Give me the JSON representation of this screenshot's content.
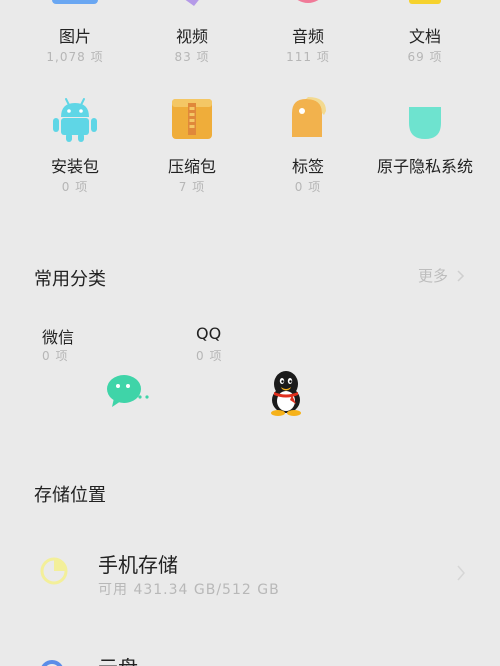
{
  "categories_row1": [
    {
      "label": "图片",
      "count": "1,078 项",
      "icon": "image-icon"
    },
    {
      "label": "视频",
      "count": "83 项",
      "icon": "video-icon"
    },
    {
      "label": "音频",
      "count": "111 项",
      "icon": "audio-icon"
    },
    {
      "label": "文档",
      "count": "69 项",
      "icon": "document-icon"
    }
  ],
  "categories_row2": [
    {
      "label": "安装包",
      "count": "0 项",
      "icon": "android-icon"
    },
    {
      "label": "压缩包",
      "count": "7 项",
      "icon": "archive-icon"
    },
    {
      "label": "标签",
      "count": "0 项",
      "icon": "tag-icon"
    },
    {
      "label": "原子隐私系统",
      "count": "",
      "icon": "privacy-shield-icon"
    }
  ],
  "common": {
    "title": "常用分类",
    "more": "更多",
    "items": [
      {
        "label": "微信",
        "count": "0 项",
        "icon": "wechat-icon"
      },
      {
        "label": "QQ",
        "count": "0 项",
        "icon": "qq-icon"
      }
    ]
  },
  "storage": {
    "title": "存储位置",
    "phone": {
      "title": "手机存储",
      "sub": "可用 431.34 GB/512 GB"
    },
    "cloud": {
      "title": "云盘"
    }
  },
  "colors": {
    "android": "#5fd6e6",
    "archive": "#efad3a",
    "tag": "#f2b24d",
    "privacy": "#6ee3cf",
    "wechat": "#3fd4a8",
    "storage_icon": "#f3ef9a"
  }
}
